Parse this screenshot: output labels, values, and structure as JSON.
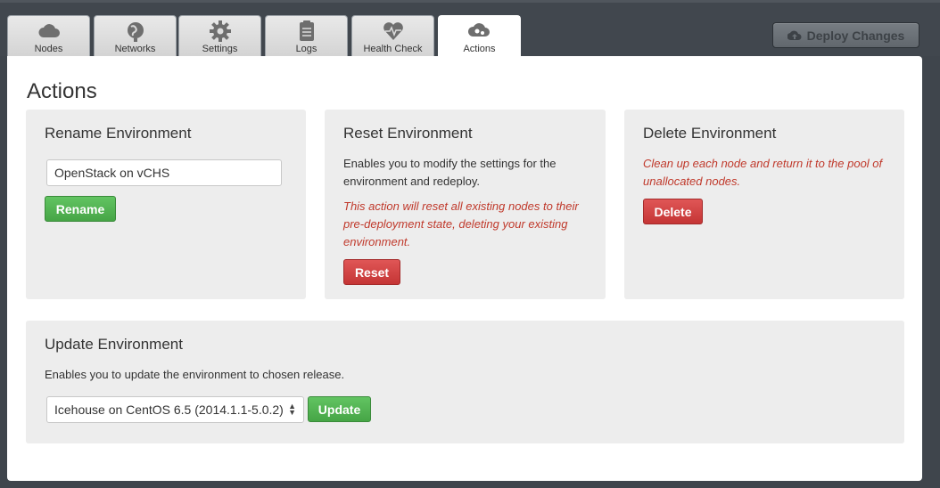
{
  "tabs": [
    {
      "label": "Nodes",
      "icon": "cloud-icon"
    },
    {
      "label": "Networks",
      "icon": "globe-icon"
    },
    {
      "label": "Settings",
      "icon": "gear-icon"
    },
    {
      "label": "Logs",
      "icon": "clipboard-icon"
    },
    {
      "label": "Health Check",
      "icon": "heart-pulse-icon"
    },
    {
      "label": "Actions",
      "icon": "cloud-gears-icon"
    }
  ],
  "active_tab": "Actions",
  "deploy_label": "Deploy Changes",
  "page_title": "Actions",
  "rename": {
    "title": "Rename Environment",
    "input_value": "OpenStack on vCHS",
    "button": "Rename"
  },
  "reset": {
    "title": "Reset Environment",
    "description": "Enables you to modify the settings for the environment and redeploy.",
    "warning": "This action will reset all existing nodes to their pre-deployment state, deleting your existing environment.",
    "button": "Reset"
  },
  "delete": {
    "title": "Delete Environment",
    "warning": "Clean up each node and return it to the pool of unallocated nodes.",
    "button": "Delete"
  },
  "update": {
    "title": "Update Environment",
    "description": "Enables you to update the environment to chosen release.",
    "selected_release": "Icehouse on CentOS 6.5 (2014.1.1-5.0.2)",
    "button": "Update"
  },
  "colors": {
    "green": "#46a546",
    "red": "#c53535",
    "warning_text": "#c0392b"
  }
}
